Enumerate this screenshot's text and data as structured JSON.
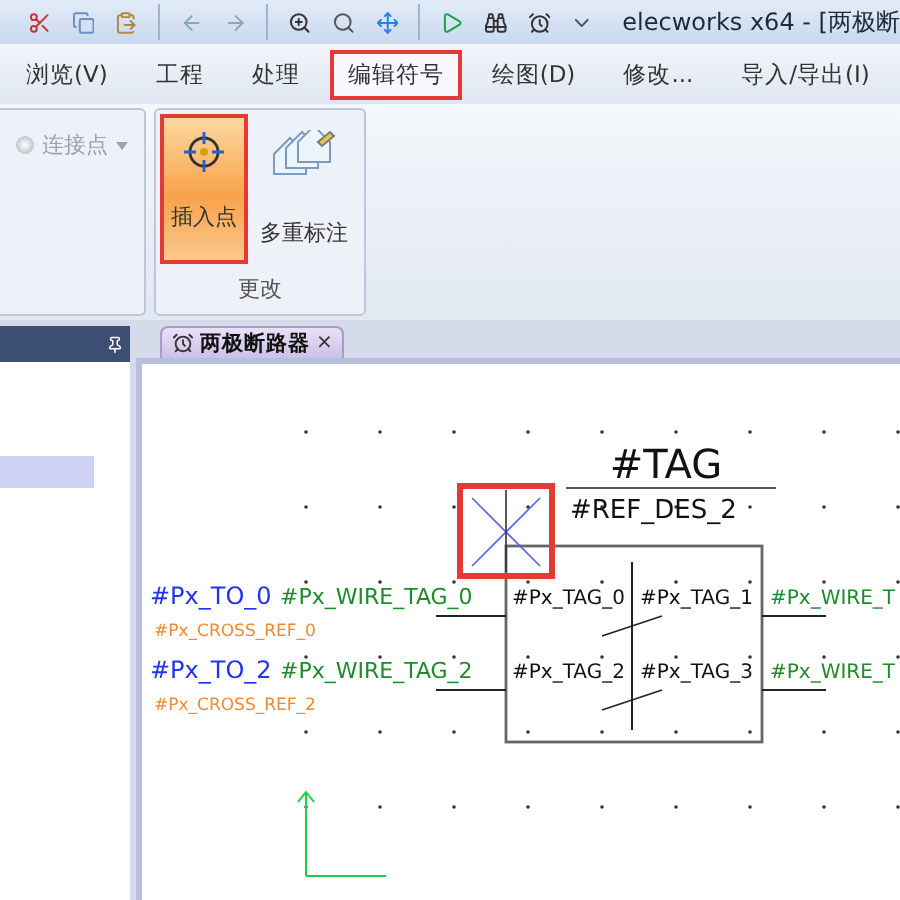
{
  "title_bar": {
    "title": "elecworks x64 - [两极断"
  },
  "menu": [
    {
      "label": "浏览(V)",
      "selected": false
    },
    {
      "label": "工程",
      "selected": false
    },
    {
      "label": "处理",
      "selected": false
    },
    {
      "label": "编辑符号",
      "selected": true
    },
    {
      "label": "绘图(D)",
      "selected": false
    },
    {
      "label": "修改...",
      "selected": false
    },
    {
      "label": "导入/导出(I)",
      "selected": false
    }
  ],
  "ribbon": {
    "connect_point": {
      "label": "连接点",
      "disabled": true
    },
    "group": {
      "label": "更改",
      "buttons": [
        {
          "label": "插入点",
          "kind": "target",
          "selected": true
        },
        {
          "label": "多重标注",
          "kind": "tags",
          "selected": false
        }
      ]
    }
  },
  "document_tab": {
    "label": "两极断路器",
    "close": "×"
  },
  "schematic": {
    "tag": "#TAG",
    "ref_des": "#REF_DES_2",
    "insert_point_selected": true,
    "terminals": [
      {
        "to": "#Px_TO_0",
        "wire_left": "#Px_WIRE_TAG_0",
        "cross_ref": "#Px_CROSS_REF_0",
        "wire_right": "#Px_WIRE_T",
        "tag_in": "#Px_TAG_0",
        "tag_out": "#Px_TAG_1"
      },
      {
        "to": "#Px_TO_2",
        "wire_left": "#Px_WIRE_TAG_2",
        "cross_ref": "#Px_CROSS_REF_2",
        "wire_right": "#Px_WIRE_T",
        "tag_in": "#Px_TAG_2",
        "tag_out": "#Px_TAG_3"
      }
    ]
  }
}
